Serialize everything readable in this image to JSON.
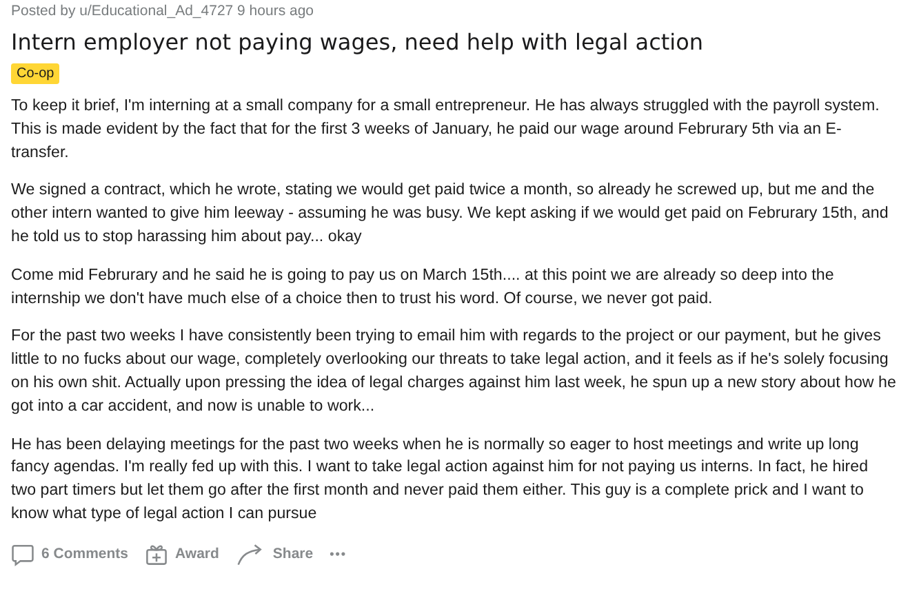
{
  "post": {
    "byline": "Posted by u/Educational_Ad_4727 9 hours ago",
    "title": "Intern employer not paying wages, need help with legal action",
    "flair": {
      "label": "Co-op",
      "color": "#ffd635"
    },
    "paragraphs": [
      "To keep it brief, I'm interning at a small company for a small entrepreneur. He has always struggled with the payroll system. This is made evident by the fact that for the first 3 weeks of January, he paid our wage around Februrary 5th via an E-transfer.",
      "We signed a contract, which he wrote, stating we would get paid twice a month, so already he screwed up, but me and the other intern wanted to give him leeway - assuming he was busy. We kept asking if we would get paid on Februrary 15th, and he told us to stop harassing him about pay... okay",
      "Come mid Februrary and he said he is going to pay us on March 15th.... at this point we are already so deep into the internship we don't have much else of a choice then to trust his word. Of course, we never got paid.",
      "For the past two weeks I have consistently been trying to email him with regards to the project or our payment, but he gives little to no fucks about our wage, completely overlooking our threats to take legal action, and it feels as if he's solely focusing on his own shit. Actually upon pressing the idea of legal charges against him last week, he spun up a new story about how he got into a car accident, and now is unable to work...",
      "He has been delaying meetings for the past two weeks when he is normally so eager to host meetings and write up long fancy agendas. I'm really fed up with this. I want to take legal action against him for not paying us interns. In fact, he hired two part timers but let them go after the first month and never paid them either. This guy is a complete prick and I want to know what type of legal action I can pursue"
    ]
  },
  "actions": [
    {
      "kind": "comments",
      "label": "6 Comments"
    },
    {
      "kind": "award",
      "label": "Award"
    },
    {
      "kind": "share",
      "label": "Share"
    },
    {
      "kind": "more",
      "label": "•••"
    }
  ]
}
